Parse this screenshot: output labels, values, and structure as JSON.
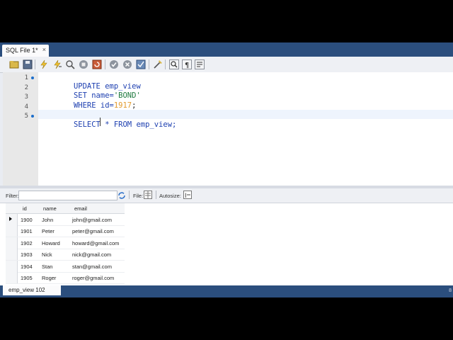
{
  "document_tab": {
    "label": "SQL File 1*",
    "close": "×"
  },
  "toolbar": {
    "buttons": [
      "open-file-icon",
      "save-icon",
      "execute-icon",
      "execute-current-icon",
      "explain-icon",
      "stop-icon",
      "refresh-icon",
      "commit-icon",
      "rollback-icon",
      "autocommit-icon",
      "beautify-icon",
      "find-icon",
      "invisible-chars-icon",
      "wrap-icon"
    ]
  },
  "editor": {
    "line_numbers": [
      "1",
      "2",
      "3",
      "4",
      "5"
    ],
    "lines": [
      [
        "UPDATE emp_view"
      ],
      [
        "SET name=",
        "'BOND'"
      ],
      [
        "WHERE id=",
        "1917",
        ";"
      ],
      [
        ""
      ],
      [
        "SELECT * FROM emp_view;"
      ]
    ]
  },
  "results_toolbar": {
    "filter_label": "Filter:",
    "filter_value": "",
    "file_label": "File:",
    "autosize_label": "Autosize:"
  },
  "grid": {
    "columns": [
      "id",
      "name",
      "email"
    ],
    "rows": [
      [
        "1900",
        "John",
        "john@gmail.com"
      ],
      [
        "1901",
        "Peter",
        "peter@gmail.com"
      ],
      [
        "1902",
        "Howard",
        "howard@gmail.com"
      ],
      [
        "1903",
        "Nick",
        "nick@gmail.com"
      ],
      [
        "1904",
        "Stan",
        "stan@gmail.com"
      ],
      [
        "1905",
        "Roger",
        "roger@gmail.com"
      ]
    ]
  },
  "result_tab": {
    "label": "emp_view 102"
  },
  "bottom_digit": "8",
  "colors": {
    "accent": "#2b4e7d",
    "keyword": "#1d3fb0",
    "string": "#1f7a3f",
    "number": "#e29a2c"
  }
}
